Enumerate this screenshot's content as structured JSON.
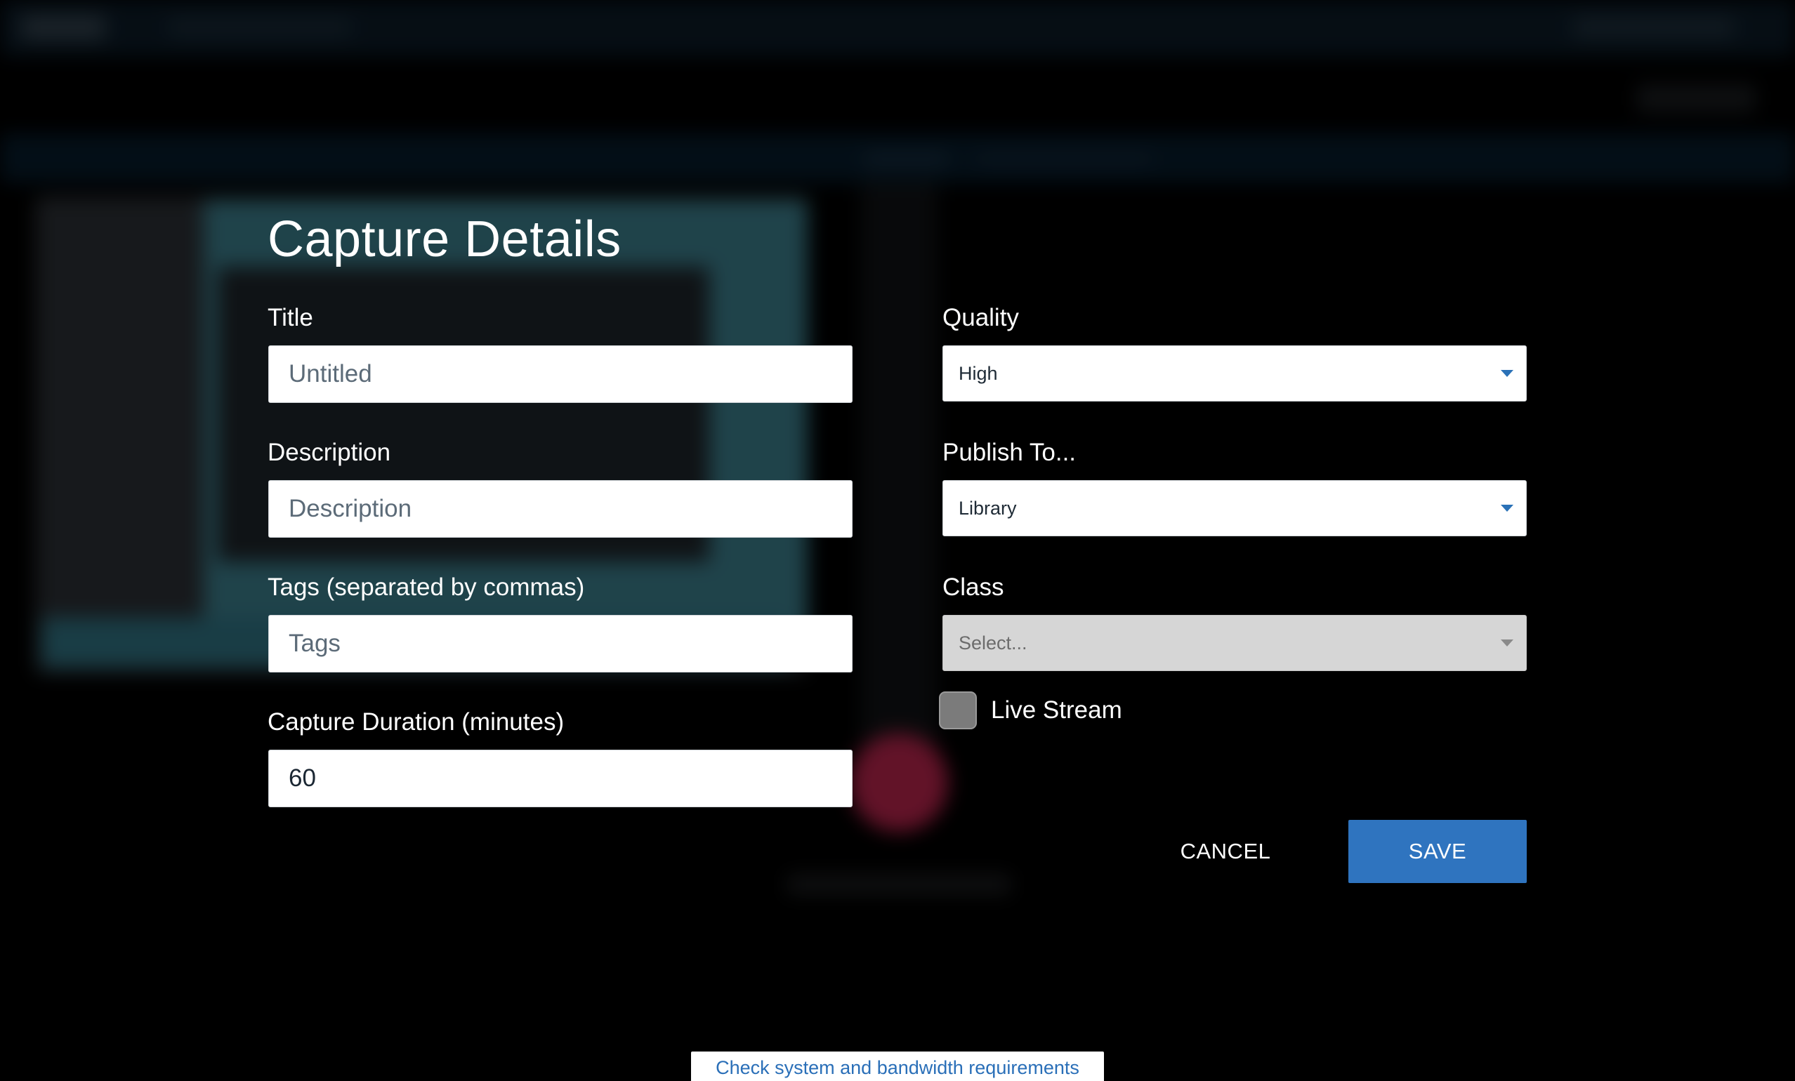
{
  "dialog": {
    "title": "Capture Details"
  },
  "fields": {
    "title": {
      "label": "Title",
      "placeholder": "Untitled",
      "value": ""
    },
    "description": {
      "label": "Description",
      "placeholder": "Description",
      "value": ""
    },
    "tags": {
      "label": "Tags (separated by commas)",
      "placeholder": "Tags",
      "value": ""
    },
    "duration": {
      "label": "Capture Duration (minutes)",
      "placeholder": "",
      "value": "60"
    },
    "quality": {
      "label": "Quality",
      "selected": "High",
      "icon": "chevron-down-icon"
    },
    "publish_to": {
      "label": "Publish To...",
      "selected": "Library",
      "icon": "chevron-down-icon"
    },
    "class": {
      "label": "Class",
      "selected": "Select...",
      "disabled": true,
      "icon": "chevron-down-icon"
    },
    "live_stream": {
      "label": "Live Stream",
      "checked": false
    }
  },
  "actions": {
    "cancel_label": "CANCEL",
    "save_label": "SAVE"
  },
  "footer": {
    "requirements_link": "Check system and bandwidth requirements"
  },
  "colors": {
    "accent": "#2f74bf",
    "background": "#000000",
    "text": "#ffffff",
    "link": "#2a6fb8"
  }
}
